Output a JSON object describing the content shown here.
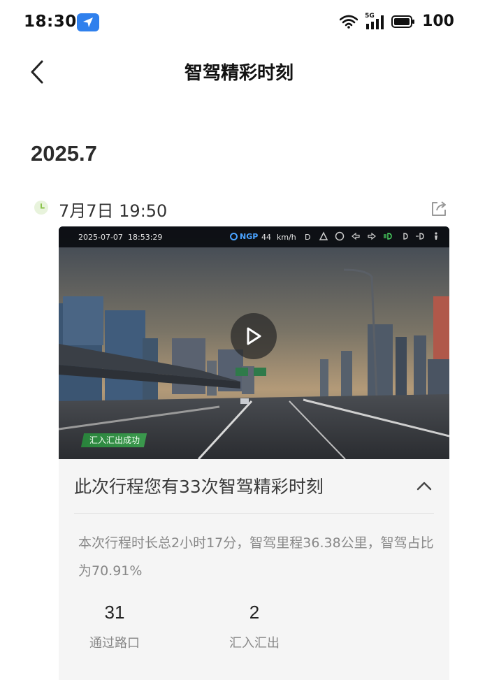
{
  "status_bar": {
    "time": "18:30",
    "icons": [
      "navigation-icon",
      "wifi-icon",
      "signal-5g-icon",
      "battery-icon"
    ],
    "network_label": "5G",
    "battery": "100"
  },
  "header": {
    "title": "智驾精彩时刻",
    "back_icon": "chevron-left-icon"
  },
  "month": "2025.7",
  "entry": {
    "timestamp": "7月7日 19:50",
    "share_icon": "share-icon",
    "video": {
      "hud_date": "2025-07-07",
      "hud_time": "18:53:29",
      "hud_mode": "NGP",
      "hud_speed": "44",
      "hud_unit": "km/h",
      "hud_gear": "D",
      "tag": "汇入汇出成功",
      "play_icon": "play-icon"
    },
    "summary": {
      "title": "此次行程您有33次智驾精彩时刻",
      "collapse_icon": "chevron-up-icon",
      "description": "本次行程时长总2小时17分，智驾里程36.38公里，智驾占比为70.91%",
      "stats": [
        {
          "value": "31",
          "label": "通过路口"
        },
        {
          "value": "2",
          "label": "汇入汇出"
        }
      ]
    }
  },
  "colors": {
    "accent_blue": "#2f80ed",
    "clock_green": "#8bc34a",
    "panel_bg": "#f5f5f5",
    "tag_green": "#3aa14f"
  }
}
